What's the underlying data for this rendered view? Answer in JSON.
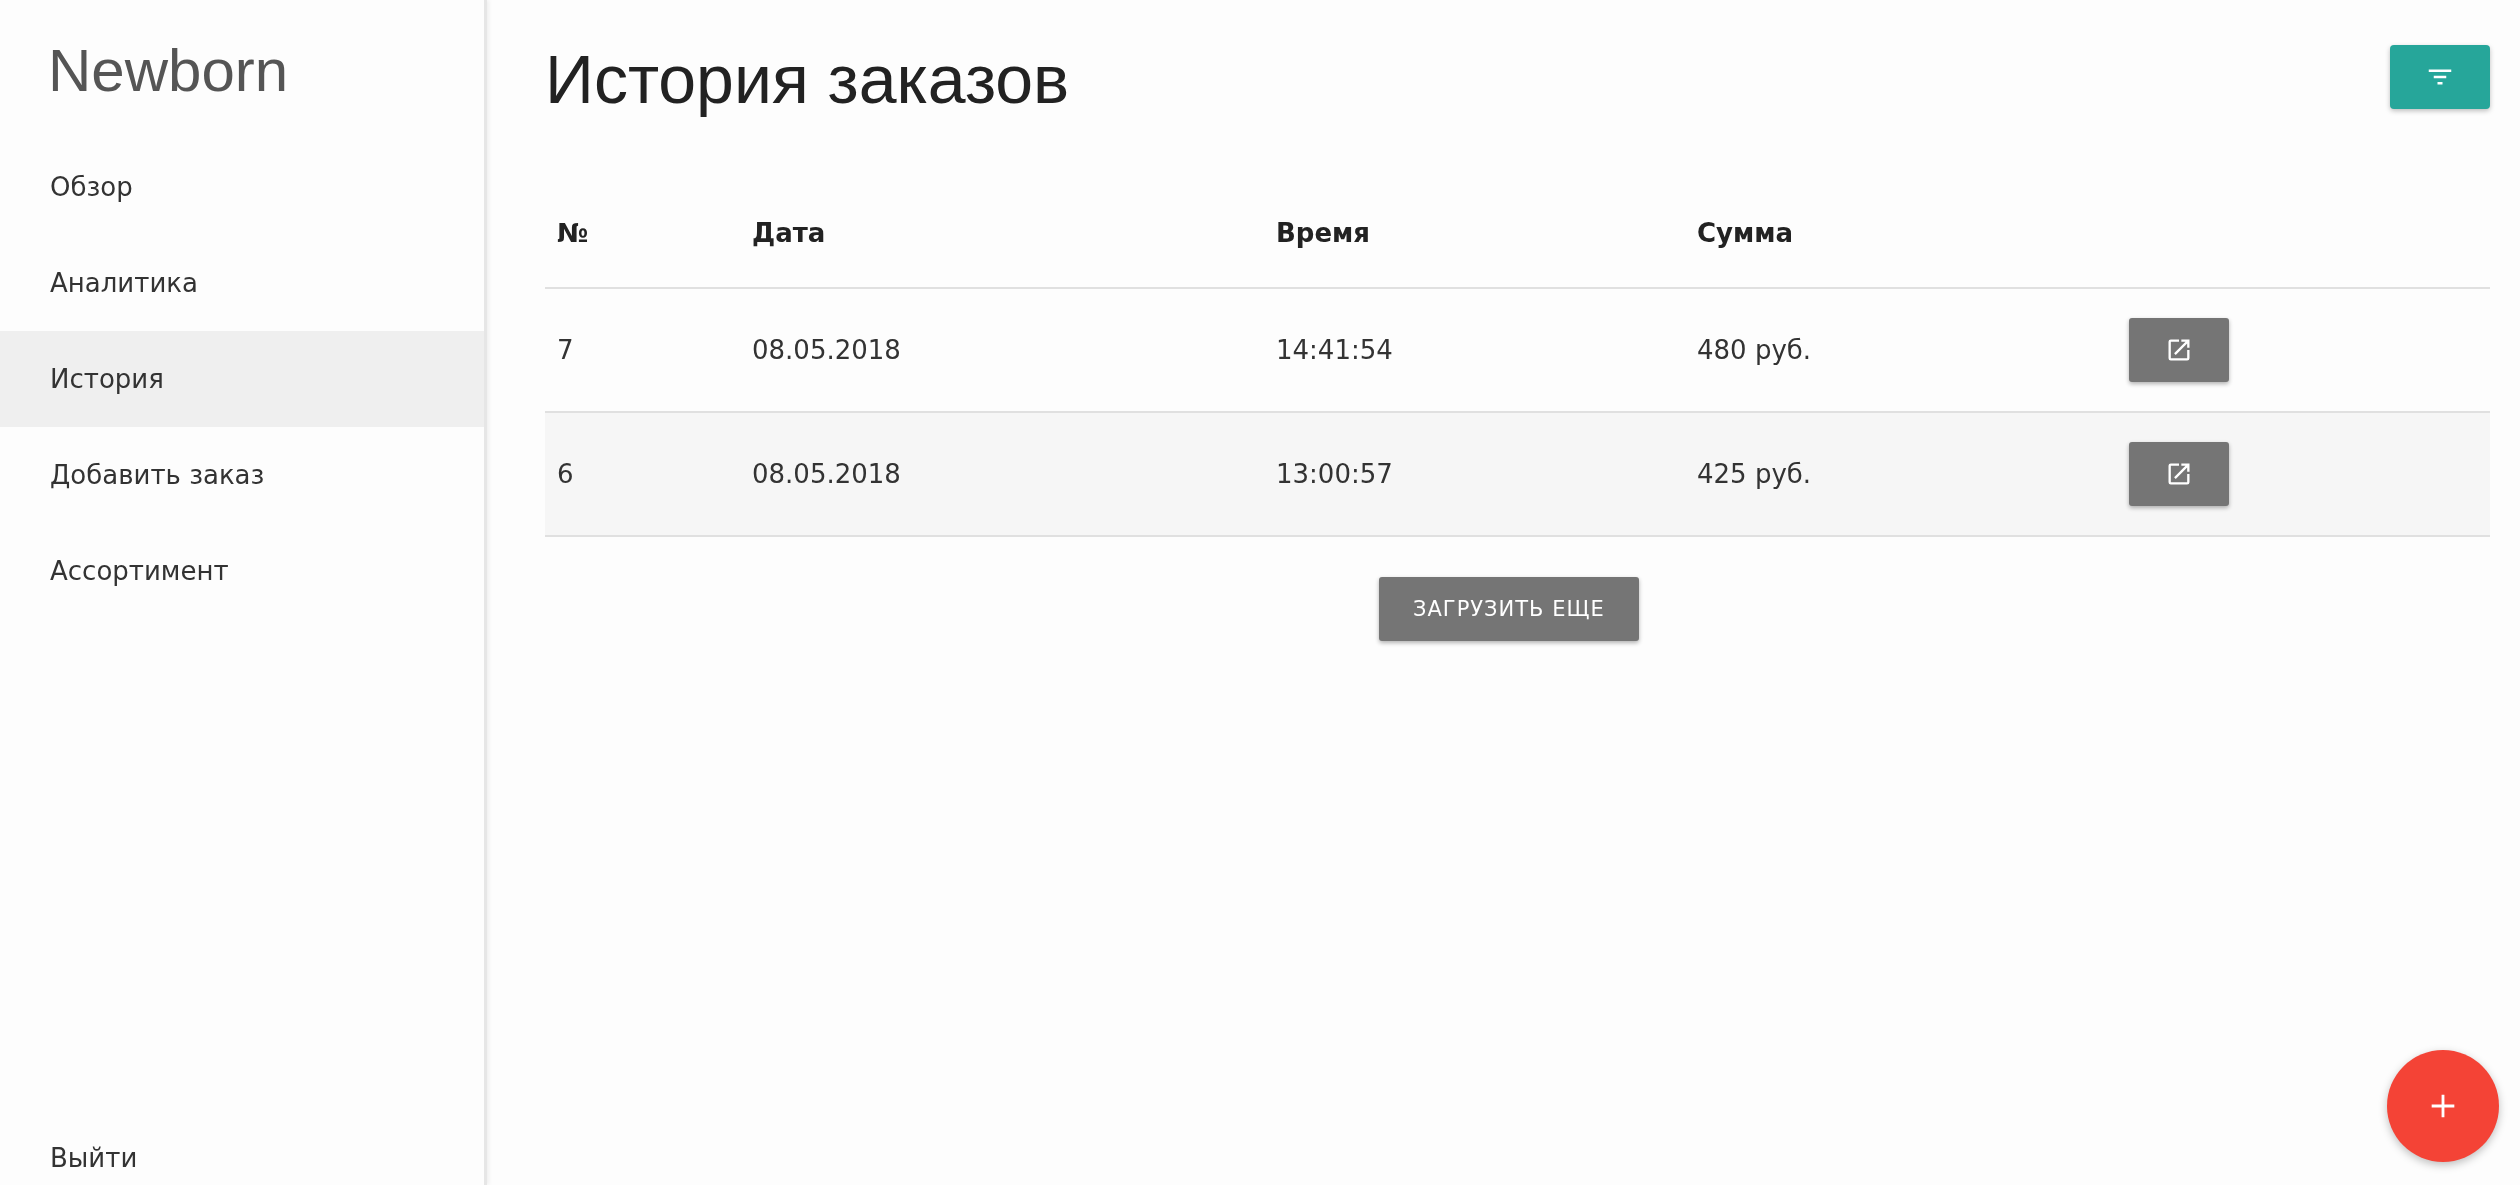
{
  "sidebar": {
    "logo": "Newborn",
    "items": [
      {
        "label": "Обзор",
        "selected": false
      },
      {
        "label": "Аналитика",
        "selected": false
      },
      {
        "label": "История",
        "selected": true
      },
      {
        "label": "Добавить заказ",
        "selected": false
      },
      {
        "label": "Ассортимент",
        "selected": false
      }
    ],
    "logout": "Выйти"
  },
  "page": {
    "title": "История заказов"
  },
  "table": {
    "columns": [
      "№",
      "Дата",
      "Время",
      "Сумма"
    ],
    "rows": [
      {
        "cells": [
          "7",
          "08.05.2018",
          "14:41:54",
          "480 руб."
        ]
      },
      {
        "cells": [
          "6",
          "08.05.2018",
          "13:00:57",
          "425 руб."
        ]
      }
    ]
  },
  "load_more": "ЗАГРУЗИТЬ ЕЩЕ"
}
